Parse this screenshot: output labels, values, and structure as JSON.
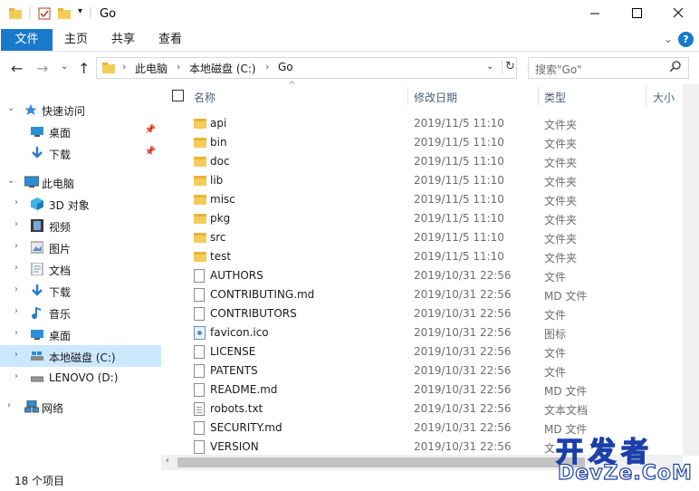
{
  "window": {
    "title": "Go",
    "minimize_icon": "minimize-icon",
    "maximize_icon": "maximize-icon",
    "close_icon": "close-icon"
  },
  "ribbon": {
    "tabs": [
      "文件",
      "主页",
      "共享",
      "查看"
    ],
    "help_label": "?"
  },
  "address": {
    "breadcrumbs": [
      "此电脑",
      "本地磁盘 (C:)",
      "Go"
    ],
    "search_placeholder": "搜索\"Go\""
  },
  "nav": {
    "items": [
      {
        "label": "快速访问",
        "icon": "star-icon"
      },
      {
        "label": "桌面",
        "icon": "desktop-icon"
      },
      {
        "label": "下载",
        "icon": "download-icon"
      },
      {
        "label": "此电脑",
        "icon": "computer-icon"
      },
      {
        "label": "3D 对象",
        "icon": "3d-objects-icon"
      },
      {
        "label": "视频",
        "icon": "video-icon"
      },
      {
        "label": "图片",
        "icon": "pictures-icon"
      },
      {
        "label": "文档",
        "icon": "documents-icon"
      },
      {
        "label": "下载",
        "icon": "download-icon"
      },
      {
        "label": "音乐",
        "icon": "music-icon"
      },
      {
        "label": "桌面",
        "icon": "desktop-icon"
      },
      {
        "label": "本地磁盘 (C:)",
        "icon": "drive-icon"
      },
      {
        "label": "LENOVO (D:)",
        "icon": "drive-icon"
      },
      {
        "label": "网络",
        "icon": "network-icon"
      }
    ]
  },
  "columns": {
    "name": "名称",
    "date": "修改日期",
    "type": "类型",
    "size": "大小"
  },
  "files": [
    {
      "name": "api",
      "date": "2019/11/5 11:10",
      "type": "文件夹",
      "kind": "folder"
    },
    {
      "name": "bin",
      "date": "2019/11/5 11:10",
      "type": "文件夹",
      "kind": "folder"
    },
    {
      "name": "doc",
      "date": "2019/11/5 11:10",
      "type": "文件夹",
      "kind": "folder"
    },
    {
      "name": "lib",
      "date": "2019/11/5 11:10",
      "type": "文件夹",
      "kind": "folder"
    },
    {
      "name": "misc",
      "date": "2019/11/5 11:10",
      "type": "文件夹",
      "kind": "folder"
    },
    {
      "name": "pkg",
      "date": "2019/11/5 11:10",
      "type": "文件夹",
      "kind": "folder"
    },
    {
      "name": "src",
      "date": "2019/11/5 11:10",
      "type": "文件夹",
      "kind": "folder"
    },
    {
      "name": "test",
      "date": "2019/11/5 11:10",
      "type": "文件夹",
      "kind": "folder"
    },
    {
      "name": "AUTHORS",
      "date": "2019/10/31 22:56",
      "type": "文件",
      "kind": "file"
    },
    {
      "name": "CONTRIBUTING.md",
      "date": "2019/10/31 22:56",
      "type": "MD 文件",
      "kind": "file"
    },
    {
      "name": "CONTRIBUTORS",
      "date": "2019/10/31 22:56",
      "type": "文件",
      "kind": "file"
    },
    {
      "name": "favicon.ico",
      "date": "2019/10/31 22:56",
      "type": "图标",
      "kind": "ico"
    },
    {
      "name": "LICENSE",
      "date": "2019/10/31 22:56",
      "type": "文件",
      "kind": "file"
    },
    {
      "name": "PATENTS",
      "date": "2019/10/31 22:56",
      "type": "文件",
      "kind": "file"
    },
    {
      "name": "README.md",
      "date": "2019/10/31 22:56",
      "type": "MD 文件",
      "kind": "file"
    },
    {
      "name": "robots.txt",
      "date": "2019/10/31 22:56",
      "type": "文本文档",
      "kind": "txt"
    },
    {
      "name": "SECURITY.md",
      "date": "2019/10/31 22:56",
      "type": "MD 文件",
      "kind": "file"
    },
    {
      "name": "VERSION",
      "date": "2019/10/31 22:56",
      "type": "文",
      "kind": "file"
    }
  ],
  "status": {
    "item_count": "18 个项目"
  },
  "watermark": {
    "line1": "开发者",
    "line2": "DevZe.CoM"
  },
  "colors": {
    "accent": "#1979ca",
    "selection": "#cce8ff",
    "folder": "#f4cc5a"
  }
}
